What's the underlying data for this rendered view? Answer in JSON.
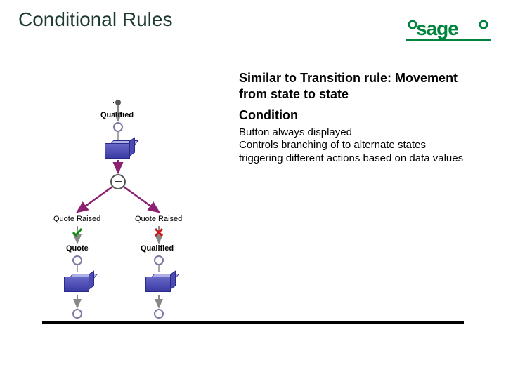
{
  "title": "Conditional Rules",
  "logo_text": "sage",
  "text": {
    "heading1": "Similar to Transition rule: Movement from state to state",
    "heading2": "Condition",
    "body1": "Button always displayed",
    "body2": "Controls branching of to alternate states triggering different actions based on data values"
  },
  "diagram": {
    "top_ring_label": ".",
    "qualified_label": "Qualified",
    "minus_label": "",
    "left_branch_label": "Quote Raised",
    "right_branch_label": "Quote Raised",
    "left_state_label": "Quote",
    "right_state_label": "Qualified",
    "left_status": "ok",
    "right_status": "no"
  },
  "colors": {
    "brand_green": "#00843d",
    "arrow": "#8a2171"
  }
}
